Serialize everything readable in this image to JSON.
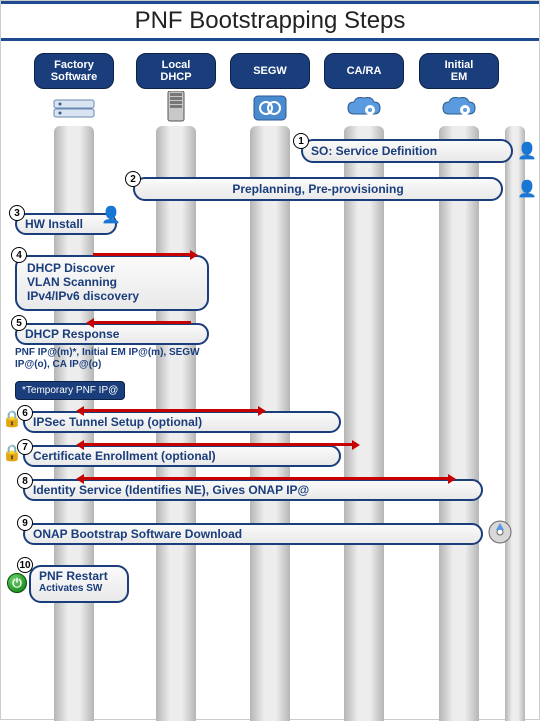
{
  "title": "PNF Bootstrapping Steps",
  "columns": {
    "c1": "Factory\nSoftware",
    "c2": "Local\nDHCP",
    "c3": "SEGW",
    "c4": "CA/RA",
    "c5": "Initial\nEM"
  },
  "steps": {
    "s1": "SO: Service Definition",
    "s2": "Preplanning, Pre-provisioning",
    "s3": "HW Install",
    "s4a": "DHCP Discover",
    "s4b": "VLAN Scanning",
    "s4c": "IPv4/IPv6 discovery",
    "s5": "DHCP Response",
    "s5sub": "PNF IP@(m)*, Initial EM IP@(m), SEGW IP@(o), CA IP@(o)",
    "note": "*Temporary PNF IP@",
    "s6": "IPSec Tunnel Setup (optional)",
    "s7": "Certificate Enrollment (optional)",
    "s8": "Identity Service (Identifies NE), Gives ONAP IP@",
    "s9": "ONAP Bootstrap Software Download",
    "s10a": "PNF Restart",
    "s10b": "Activates SW"
  },
  "numbers": {
    "n1": "1",
    "n2": "2",
    "n3": "3",
    "n4": "4",
    "n5": "5",
    "n6": "6",
    "n7": "7",
    "n8": "8",
    "n9": "9",
    "n10": "10"
  }
}
